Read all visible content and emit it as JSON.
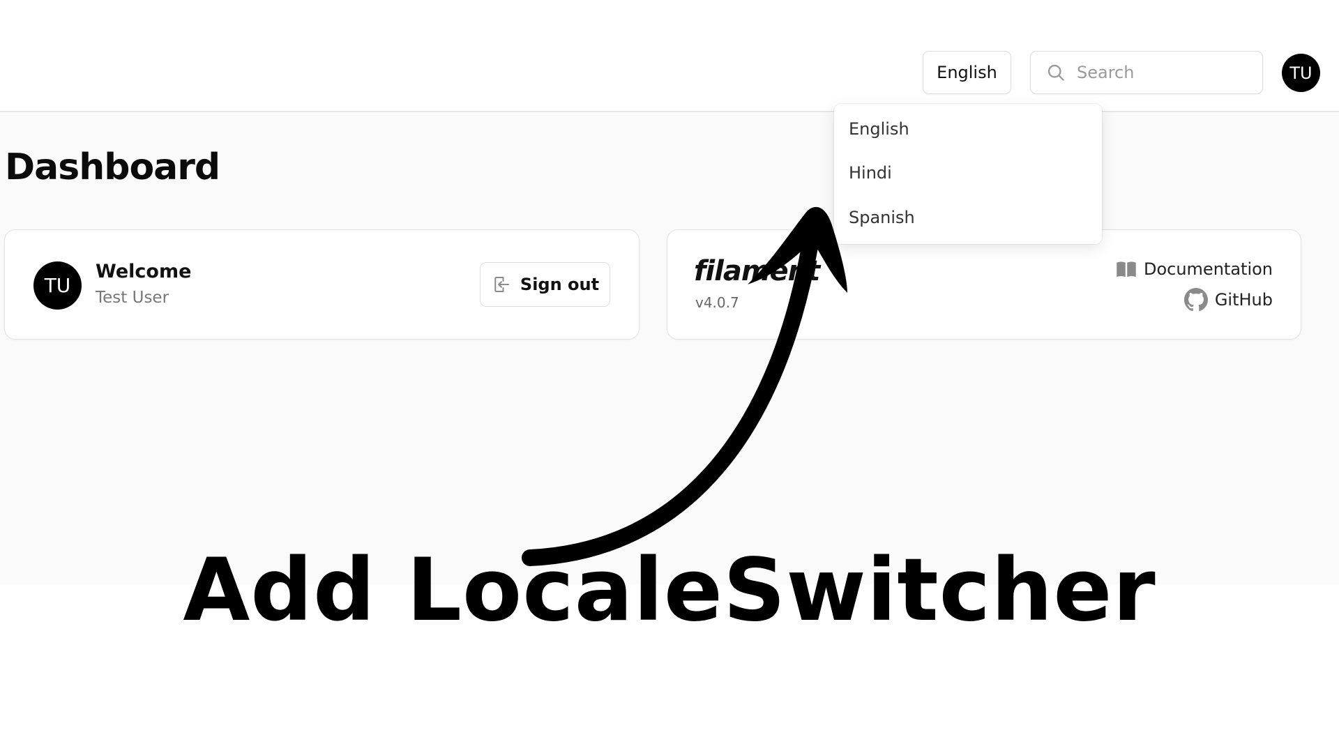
{
  "header": {
    "locale_button_label": "English",
    "search_placeholder": "Search",
    "user_initials": "TU"
  },
  "locale_dropdown": {
    "options": [
      "English",
      "Hindi",
      "Spanish"
    ]
  },
  "page": {
    "title": "Dashboard"
  },
  "account_widget": {
    "initials": "TU",
    "title": "Welcome",
    "user_name": "Test User",
    "sign_out_label": "Sign out"
  },
  "info_widget": {
    "logo_text": "filament",
    "version": "v4.0.7",
    "documentation_label": "Documentation",
    "github_label": "GitHub"
  },
  "overlay": {
    "headline": "Add LocaleSwitcher"
  },
  "icons": {
    "search": "search-icon",
    "sign_out": "sign-out-icon",
    "documentation": "book-open-icon",
    "github": "github-icon",
    "arrow": "curved-arrow-icon"
  },
  "colors": {
    "avatar_bg": "#000000",
    "page_bg": "#fafafa",
    "card_bg": "#ffffff",
    "headline": "#000000"
  }
}
